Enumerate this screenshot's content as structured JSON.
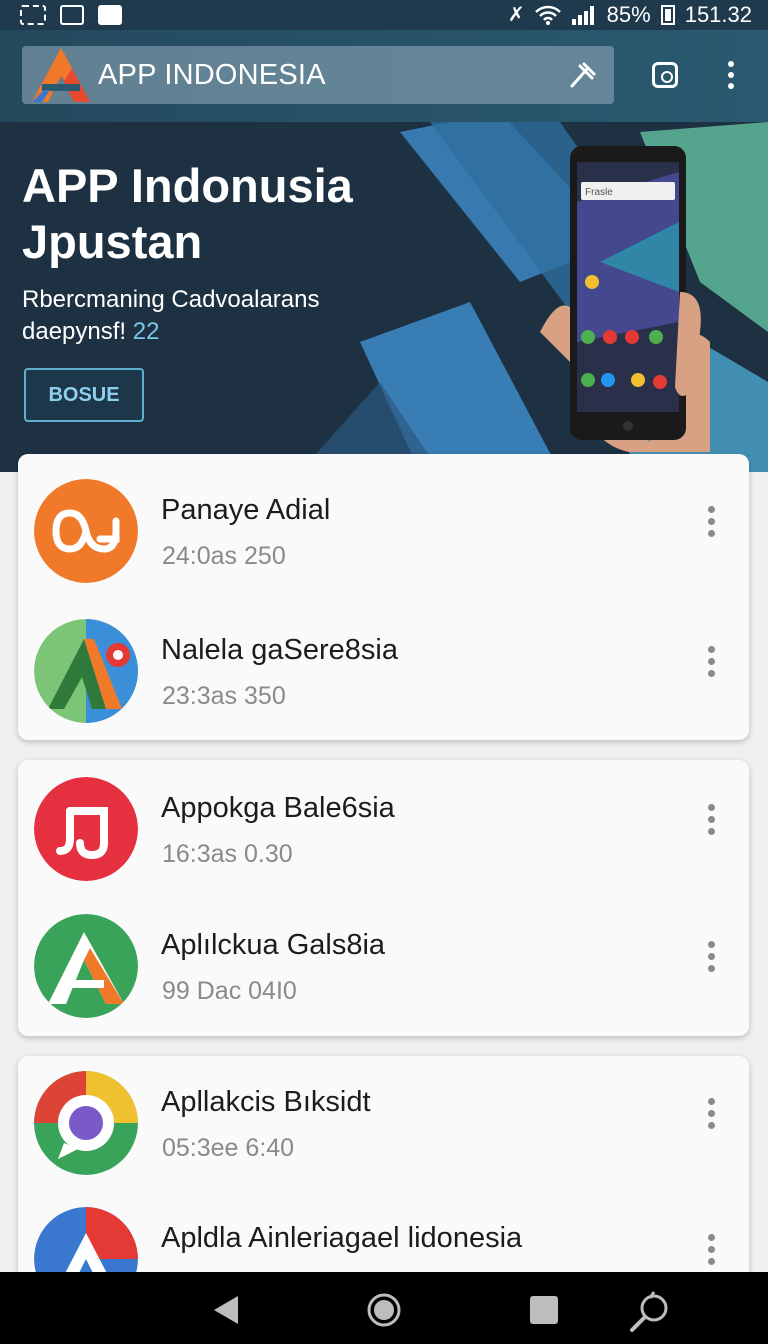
{
  "status_bar": {
    "battery_text": "85%",
    "time": "151.32",
    "icons": [
      "signal-mute-icon",
      "wifi-icon",
      "cell-signal-icon",
      "battery-icon"
    ]
  },
  "app_bar": {
    "app_name": "APP INDONESIA",
    "icons": [
      "app-logo-icon",
      "mic-icon",
      "screen-icon",
      "more-icon"
    ]
  },
  "hero": {
    "title_line1": "APP Indonusia",
    "title_line2": "Jpustan",
    "subtitle_line1": "Rbercmaning Cadvoalarans",
    "subtitle_line2": "daepynsf!",
    "subtitle_number": "22",
    "button_label": "BOSUE",
    "phone_search_text": "Frasle"
  },
  "cards": [
    {
      "items": [
        {
          "title": "Panaye Adial",
          "meta": "24:0as 250",
          "icon": "orange-loop-icon",
          "color": "#f07a2a"
        },
        {
          "title": "Nalela gaSere8sia",
          "meta": "23:3as 350",
          "icon": "green-a-gear-icon",
          "color": "#4caf50"
        }
      ]
    },
    {
      "items": [
        {
          "title": "Appokga Bale6sia",
          "meta": "16:3as 0.30",
          "icon": "red-music-icon",
          "color": "#e53040"
        },
        {
          "title": "Aplılckua Gals8ia",
          "meta": "99 Dac 04I0",
          "icon": "green-a-icon",
          "color": "#3aa35a"
        }
      ]
    },
    {
      "items": [
        {
          "title": "Apllakcis Bıksidt",
          "meta": "05:3ee 6:40",
          "icon": "chat-bubble-icon",
          "color": "#db4437"
        },
        {
          "title": "Apldla Ainleriagael lidonesia",
          "meta": "",
          "icon": "blue-a-icon",
          "color": "#3a78d0"
        }
      ]
    }
  ],
  "nav_bar": {
    "buttons": [
      "back-icon",
      "home-icon",
      "recents-icon",
      "search-icon"
    ]
  }
}
